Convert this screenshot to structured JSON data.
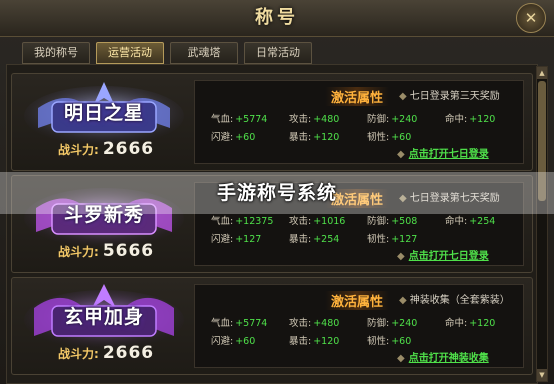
{
  "window": {
    "title": "称号",
    "close_glyph": "✕"
  },
  "tabs": [
    {
      "label": "我的称号",
      "active": false
    },
    {
      "label": "运营活动",
      "active": true
    },
    {
      "label": "武魂塔",
      "active": false
    },
    {
      "label": "日常活动",
      "active": false
    }
  ],
  "power_label": "战斗力:",
  "activate_label": "激活属性",
  "stat_labels": {
    "hp": "气血:",
    "atk": "攻击:",
    "def": "防御:",
    "hit": "命中:",
    "dodge": "闪避:",
    "crit": "暴击:",
    "tough": "韧性:"
  },
  "items": [
    {
      "name": "明日之星",
      "power": "2666",
      "desc": "七日登录第三天奖励",
      "stats": {
        "hp": "+5774",
        "atk": "+480",
        "def": "+240",
        "hit": "+120",
        "dodge": "+60",
        "crit": "+120",
        "tough": "+60"
      },
      "link": "点击打开七日登录",
      "colors": {
        "wing": "#6a78d8",
        "glow": "#9aa6ff"
      }
    },
    {
      "name": "斗罗新秀",
      "power": "5666",
      "desc": "七日登录第七天奖励",
      "stats": {
        "hp": "+12375",
        "atk": "+1016",
        "def": "+508",
        "hit": "+254",
        "dodge": "+127",
        "crit": "+254",
        "tough": "+127"
      },
      "link": "点击打开七日登录",
      "colors": {
        "wing": "#b050d8",
        "glow": "#d890ff"
      }
    },
    {
      "name": "玄甲加身",
      "power": "2666",
      "desc": "神装收集（全套紫装）",
      "stats": {
        "hp": "+5774",
        "atk": "+480",
        "def": "+240",
        "hit": "+120",
        "dodge": "+60",
        "crit": "+120",
        "tough": "+60"
      },
      "link": "点击打开神装收集",
      "colors": {
        "wing": "#9a40d0",
        "glow": "#c07cff"
      }
    }
  ],
  "overlay_caption": "手游称号系统"
}
